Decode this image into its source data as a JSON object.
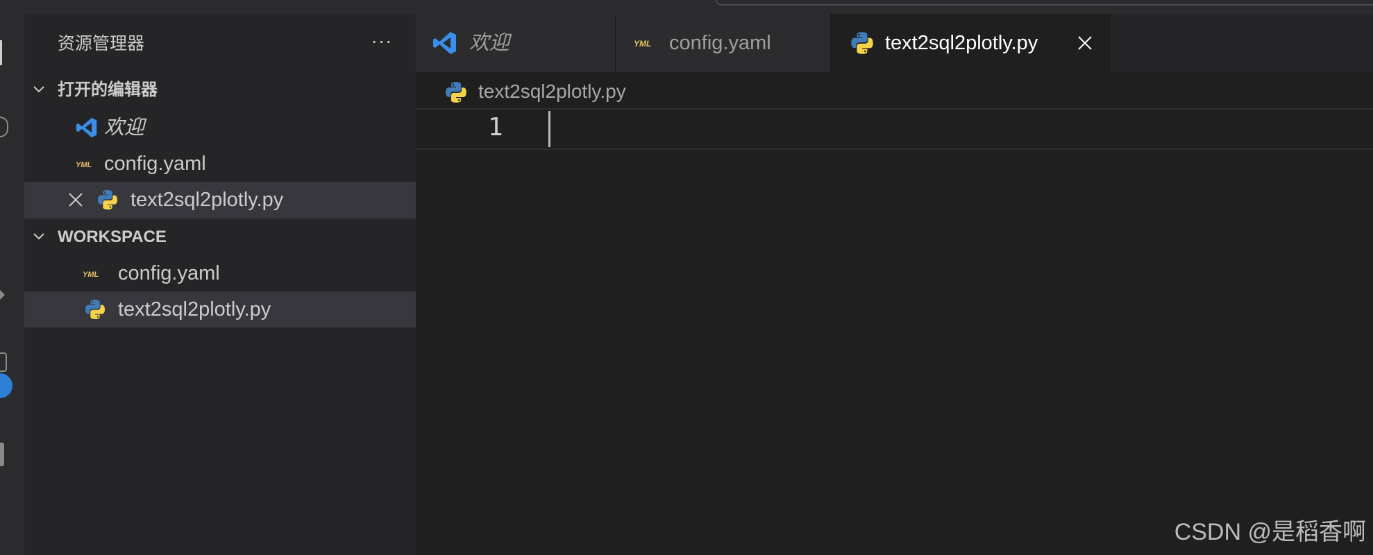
{
  "sidebar": {
    "title": "资源管理器",
    "more": "···",
    "open_editors": {
      "label": "打开的编辑器",
      "items": [
        {
          "name": "欢迎",
          "icon": "vscode-icon"
        },
        {
          "name": "config.yaml",
          "icon": "yaml-icon"
        },
        {
          "name": "text2sql2plotly.py",
          "icon": "python-icon"
        }
      ]
    },
    "workspace": {
      "label": "WORKSPACE",
      "items": [
        {
          "name": "config.yaml",
          "icon": "yaml-icon"
        },
        {
          "name": "text2sql2plotly.py",
          "icon": "python-icon"
        }
      ]
    }
  },
  "tabs": [
    {
      "label": "欢迎",
      "icon": "vscode-icon"
    },
    {
      "label": "config.yaml",
      "icon": "yaml-icon"
    },
    {
      "label": "text2sql2plotly.py",
      "icon": "python-icon"
    }
  ],
  "editor": {
    "breadcrumb": "text2sql2plotly.py",
    "line_number": "1"
  },
  "watermark": "CSDN @是稻香啊",
  "colors": {
    "vscode_blue": "#3b8eea",
    "yaml_label": "#e8c068",
    "python_blue": "#3f7cb8",
    "python_yellow": "#f6d24a",
    "accent": "#2f7fd6"
  }
}
